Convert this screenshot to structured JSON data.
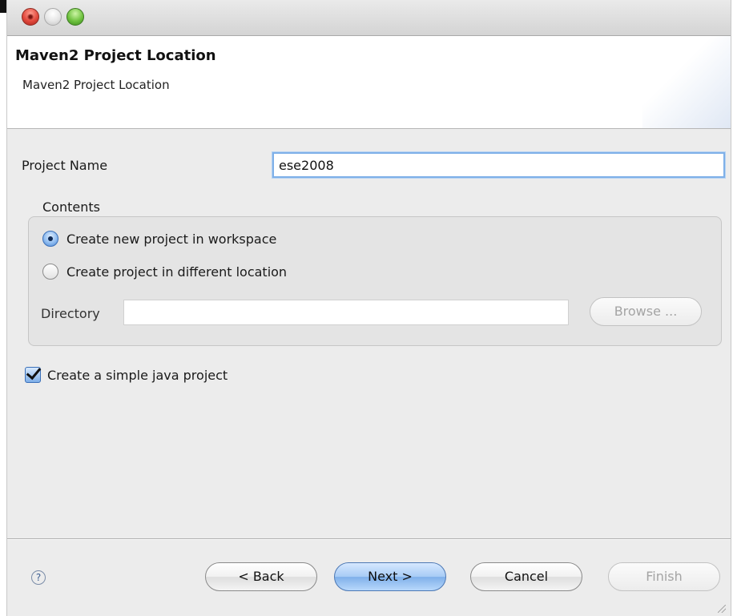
{
  "header": {
    "title": "Maven2 Project Location",
    "subtitle": "Maven2 Project Location"
  },
  "form": {
    "project_name_label": "Project Name",
    "project_name_value": "ese2008",
    "contents_label": "Contents",
    "radio_workspace_label": "Create new project in workspace",
    "radio_workspace_checked": true,
    "radio_location_label": "Create project in different location",
    "radio_location_checked": false,
    "directory_label": "Directory",
    "directory_value": "",
    "browse_label": "Browse ...",
    "simple_project_label": "Create a simple java project",
    "simple_project_checked": true
  },
  "footer": {
    "help_glyph": "?",
    "back_label": "< Back",
    "next_label": "Next >",
    "cancel_label": "Cancel",
    "finish_label": "Finish"
  },
  "icons": {
    "close": "close-light-icon",
    "minimize": "minimize-light-icon",
    "zoom": "zoom-light-icon",
    "help": "help-icon",
    "grip": "resize-grip-icon"
  },
  "colors": {
    "focus_ring": "#7fb0e8",
    "default_button": "#7fb0ea",
    "close_light": "#e2493d",
    "zoom_light": "#6fc23f"
  }
}
